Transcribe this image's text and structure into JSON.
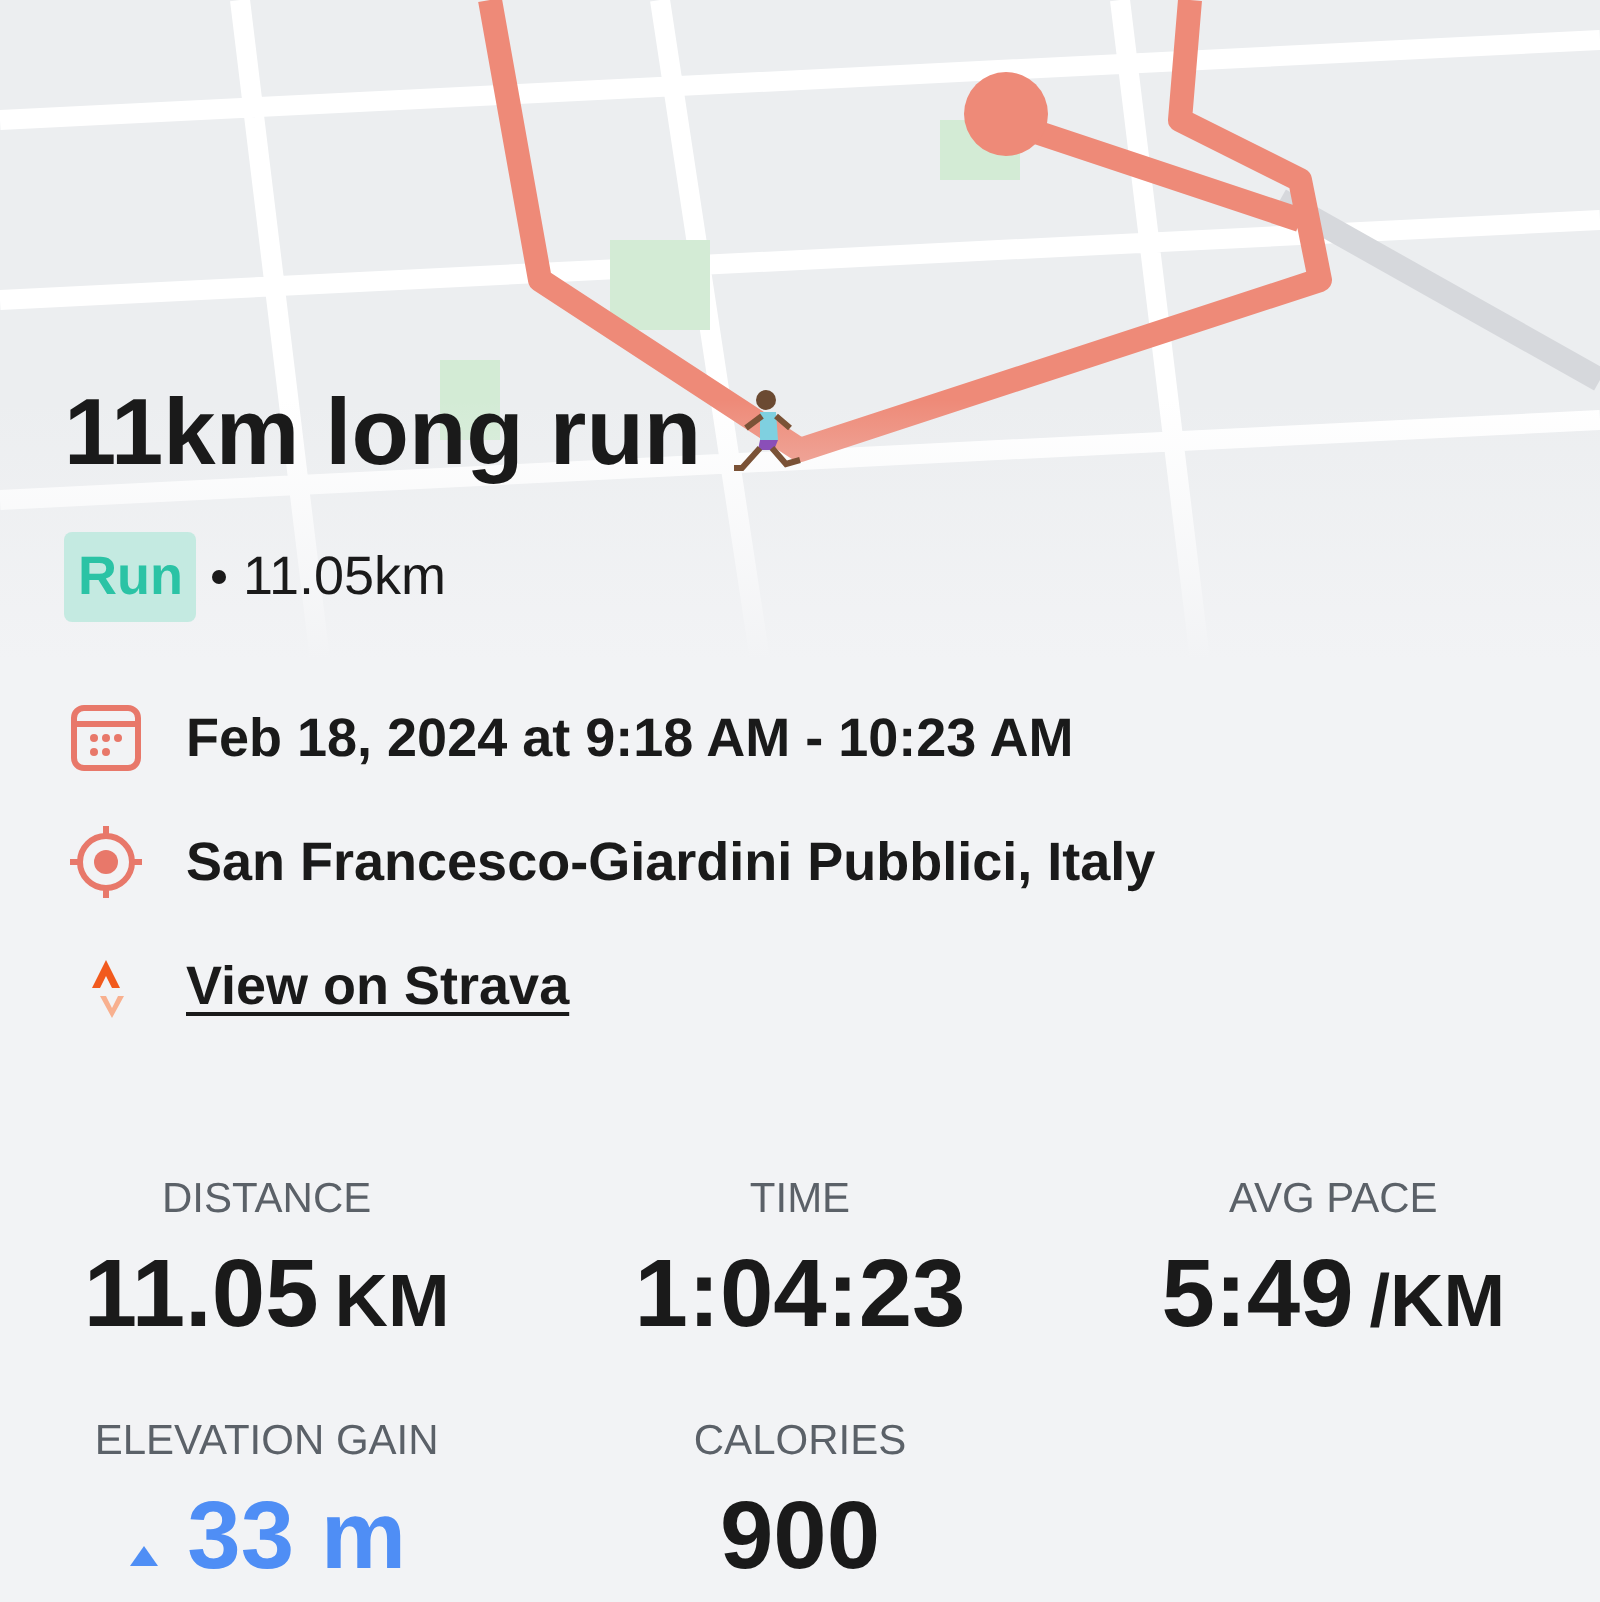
{
  "activity": {
    "title": "11km long run",
    "type": "Run",
    "distance": "11.05km"
  },
  "details": [
    {
      "kind": "date",
      "text": "Feb 18, 2024 at 9:18 AM - 10:23 AM"
    },
    {
      "kind": "location",
      "text": "San Francesco-Giardini Pubblici, Italy"
    },
    {
      "kind": "link",
      "text": "View on Strava"
    }
  ],
  "stats": [
    {
      "kind": "plain",
      "label": "DISTANCE",
      "value": "11.05",
      "unit": "KM"
    },
    {
      "kind": "plain",
      "label": "TIME",
      "value": "1:04:23"
    },
    {
      "kind": "plain",
      "label": "AVG PACE",
      "value": "5:49",
      "unit": "/KM"
    },
    {
      "kind": "gain",
      "label": "ELEVATION GAIN",
      "value": "33 m"
    },
    {
      "kind": "plain",
      "label": "CALORIES",
      "value": "900"
    }
  ]
}
